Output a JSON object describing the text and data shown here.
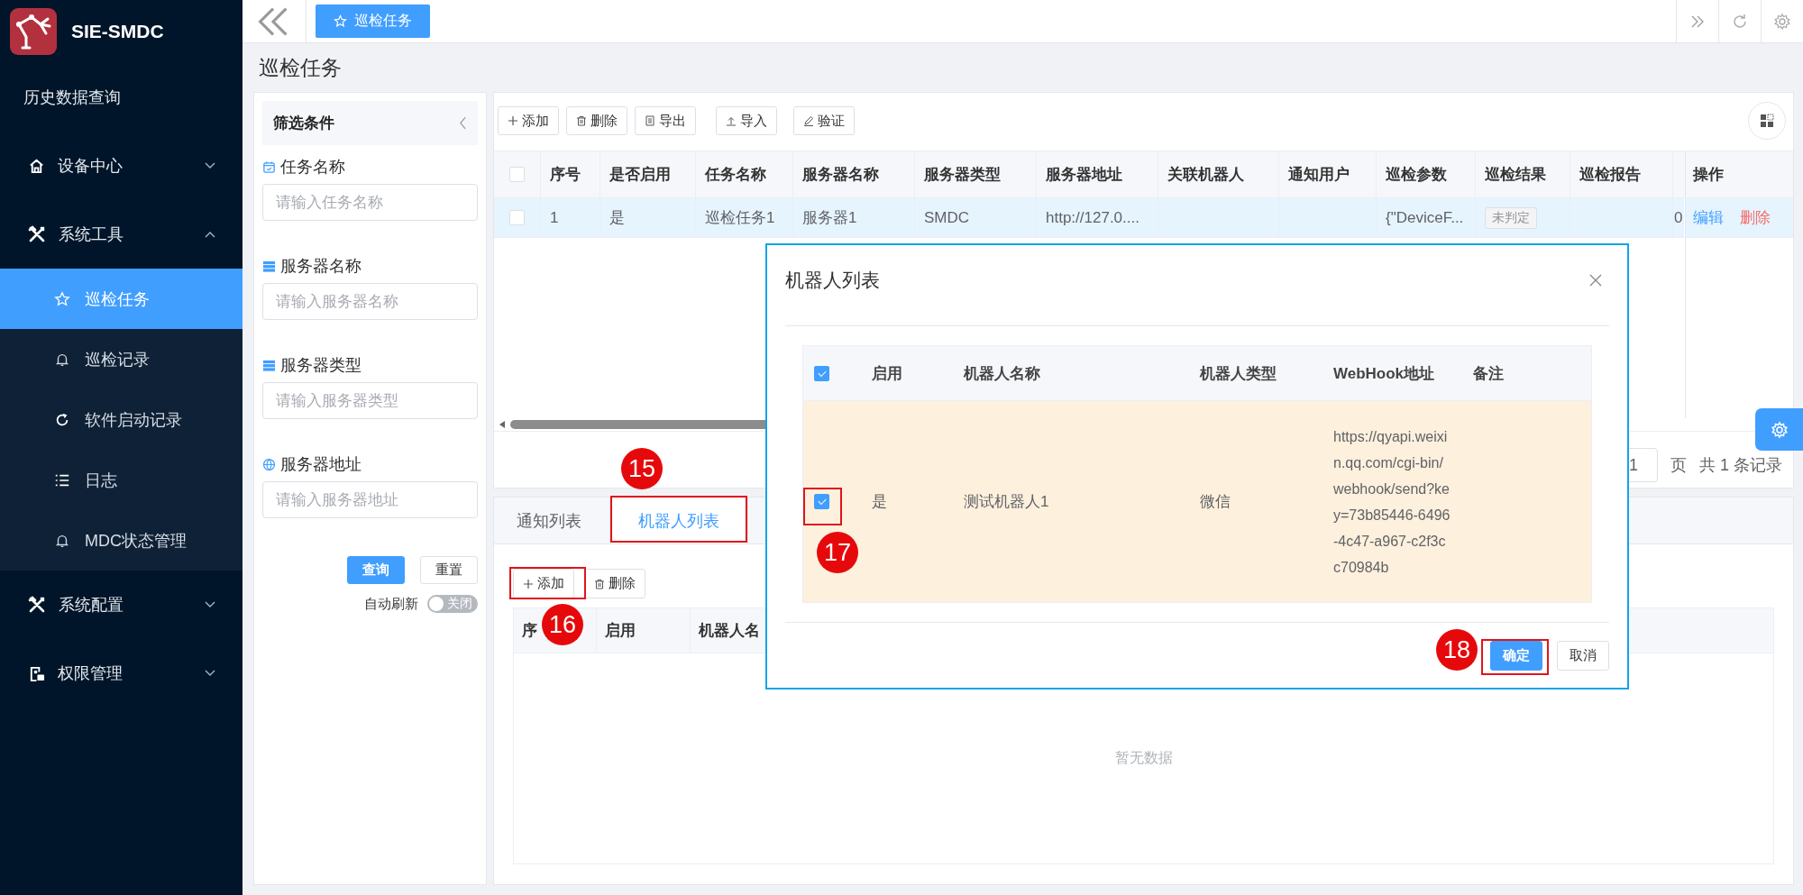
{
  "sidebar": {
    "logo_text": "SIE-SMDC",
    "items": [
      {
        "label": "历史数据查询",
        "selected": false
      },
      {
        "label": "设备中心",
        "selected": false,
        "expanded": false
      },
      {
        "label": "系统工具",
        "selected": false,
        "expanded": true,
        "children": [
          {
            "label": "巡检任务",
            "selected": true
          },
          {
            "label": "巡检记录",
            "selected": false
          },
          {
            "label": "软件启动记录",
            "selected": false
          },
          {
            "label": "日志",
            "selected": false
          },
          {
            "label": "MDC状态管理",
            "selected": false
          }
        ]
      },
      {
        "label": "系统配置",
        "selected": false,
        "expanded": false
      },
      {
        "label": "权限管理",
        "selected": false,
        "expanded": false
      }
    ]
  },
  "tabs": [
    {
      "label": "巡检任务",
      "selected": true
    }
  ],
  "page_title": "巡检任务",
  "filter": {
    "title": "筛选条件",
    "fields": [
      {
        "label": "任务名称",
        "placeholder": "请输入任务名称"
      },
      {
        "label": "服务器名称",
        "placeholder": "请输入服务器名称"
      },
      {
        "label": "服务器类型",
        "placeholder": "请输入服务器类型"
      },
      {
        "label": "服务器地址",
        "placeholder": "请输入服务器地址"
      }
    ],
    "buttons": [
      "查询",
      "重置"
    ],
    "auto_refresh": {
      "label": "自动刷新",
      "on": false,
      "state_text": "关闭"
    }
  },
  "toolbar": [
    "添加",
    "删除",
    "导出",
    "导入",
    "验证"
  ],
  "table": {
    "all_checked": false,
    "columns": [
      "序号",
      "是否启用",
      "任务名称",
      "服务器名称",
      "服务器类型",
      "服务器地址",
      "关联机器人",
      "通知用户",
      "巡检参数",
      "巡检结果",
      "巡检报告"
    ],
    "action_column": "操作",
    "rows": [
      {
        "selected": true,
        "checked": false,
        "index": "1",
        "enabled": "是",
        "task_name": "巡检任务1",
        "server_name": "服务器1",
        "server_type": "SMDC",
        "server_address": "http://127.0....",
        "params": "{\"DeviceF...",
        "result": "未判定",
        "column_12": "0",
        "actions": [
          "编辑",
          "删除"
        ]
      }
    ]
  },
  "pagination": {
    "page": "1",
    "page_suffix": "页",
    "total": "共 1 条记录"
  },
  "bottom": {
    "tabs": [
      {
        "label": "通知列表",
        "selected": false
      },
      {
        "label": "机器人列表",
        "selected": true
      }
    ],
    "toolbar": [
      "添加",
      "删除"
    ],
    "columns": [
      "序",
      "启用",
      "机器人名"
    ],
    "empty_text": "暂无数据"
  },
  "dialog": {
    "title": "机器人列表",
    "all_checked": true,
    "columns": [
      "启用",
      "机器人名称",
      "机器人类型",
      "WebHook地址",
      "备注"
    ],
    "rows": [
      {
        "checked": true,
        "enabled": "是",
        "name": "测试机器人1",
        "type": "微信",
        "webhook": "https://qyapi.weixin.qq.com/cgi-bin/webhook/send?key=73b85446-6496-4c47-a967-c2f3cc70984b"
      }
    ],
    "buttons": [
      "确定",
      "取消"
    ]
  },
  "annotations": [
    {
      "number": "15"
    },
    {
      "number": "16"
    },
    {
      "number": "17"
    },
    {
      "number": "18"
    }
  ]
}
